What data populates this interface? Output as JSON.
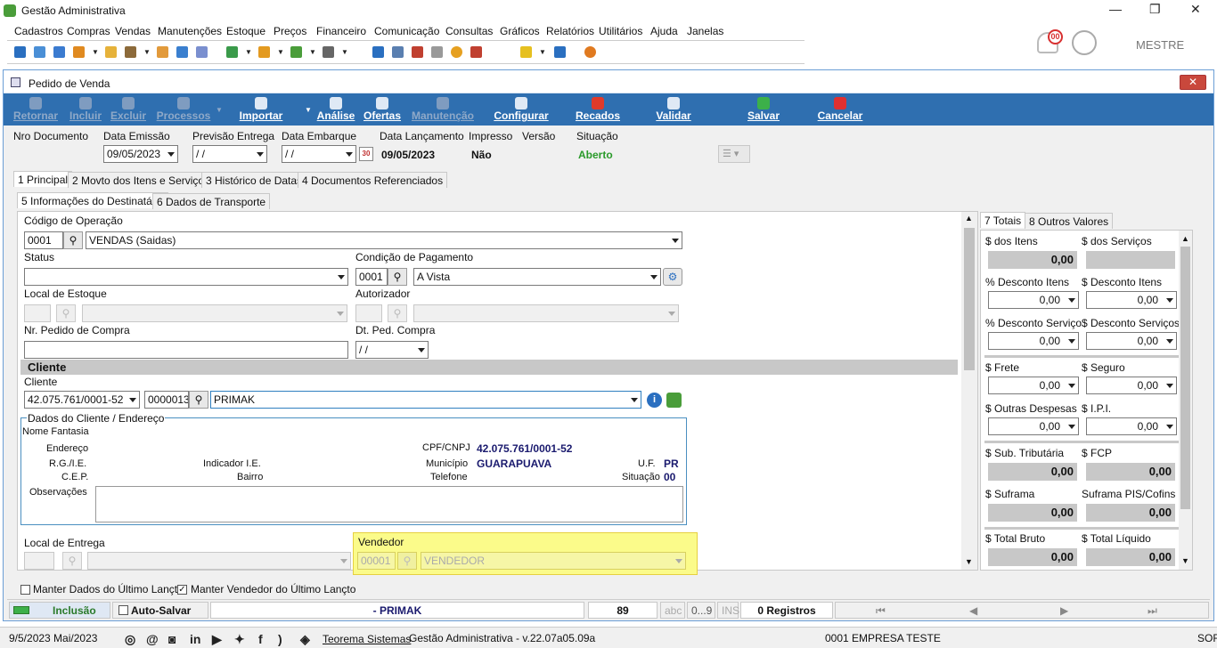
{
  "app": {
    "title": "Gestão Administrativa",
    "user": "MESTRE",
    "notif_count": "00"
  },
  "menu": [
    "Cadastros",
    "Compras",
    "Vendas",
    "Manutenções",
    "Estoque",
    "Preços",
    "Financeiro",
    "Comunicação",
    "Consultas",
    "Gráficos",
    "Relatórios",
    "Utilitários",
    "Ajuda",
    "Janelas"
  ],
  "window": {
    "title": "Pedido de Venda",
    "close": "✕"
  },
  "actions": {
    "retornar": "Retornar",
    "incluir": "Incluir",
    "excluir": "Excluir",
    "processos": "Processos",
    "importar": "Importar",
    "analise": "Análise",
    "ofertas": "Ofertas",
    "manutencao": "Manutenção",
    "configurar": "Configurar",
    "recados": "Recados",
    "validar": "Validar",
    "salvar": "Salvar",
    "cancelar": "Cancelar"
  },
  "header": {
    "nro_doc": "Nro Documento",
    "data_emissao": "Data Emissão",
    "data_emissao_val": "09/05/2023",
    "previsao": "Previsão Entrega",
    "previsao_val": "/ /",
    "embarque": "Data Embarque",
    "embarque_val": "/ /",
    "lancamento": "Data Lançamento",
    "lancamento_val": "09/05/2023",
    "impresso": "Impresso",
    "impresso_val": "Não",
    "versao": "Versão",
    "situacao": "Situação",
    "situacao_val": "Aberto"
  },
  "tabs": [
    "1 Principal",
    "2 Movto dos Itens e Serviços",
    "3 Histórico de Datas",
    "4 Documentos Referenciados"
  ],
  "subtabs": [
    "5 Informações do Destinatário",
    "6 Dados de Transporte"
  ],
  "form": {
    "cod_op_label": "Código de Operação",
    "cod_op": "0001",
    "cod_op_desc": "VENDAS (Saidas)",
    "status_label": "Status",
    "cond_label": "Condição de Pagamento",
    "cond_code": "0001",
    "cond_desc": "A Vista",
    "local_label": "Local de Estoque",
    "autoriz_label": "Autorizador",
    "nr_pedido_label": "Nr. Pedido de Compra",
    "dt_ped_label": "Dt. Ped. Compra",
    "dt_ped_val": "/ /",
    "cliente_section": "Cliente",
    "cliente_label": "Cliente",
    "cliente_cnpj": "42.075.761/0001-52",
    "cliente_code": "0000013",
    "cliente_nome": "PRIMAK",
    "dados_title": "Dados do Cliente / Endereço",
    "nome_fantasia": "Nome Fantasia",
    "endereco": "Endereço",
    "rg": "R.G./I.E.",
    "cep": "C.E.P.",
    "obs": "Observações",
    "indicador": "Indicador I.E.",
    "bairro": "Bairro",
    "cpf_label": "CPF/CNPJ",
    "cpf_val": "42.075.761/0001-52",
    "municipio_label": "Município",
    "municipio_val": "GUARAPUAVA",
    "telefone_label": "Telefone",
    "uf_label": "U.F.",
    "uf_val": "PR",
    "situacao_label": "Situação",
    "situacao_val": "00",
    "local_entrega": "Local de Entrega",
    "vendedor_label": "Vendedor",
    "vendedor_code": "00001",
    "vendedor_desc": "VENDEDOR"
  },
  "totals": {
    "tab1": "7 Totais",
    "tab2": "8 Outros Valores",
    "dos_itens": "$ dos Itens",
    "dos_itens_val": "0,00",
    "dos_servicos": "$ dos Serviços",
    "pct_desc_itens": "% Desconto Itens",
    "pct_desc_itens_val": "0,00",
    "desc_itens": "$ Desconto Itens",
    "desc_itens_val": "0,00",
    "pct_desc_serv": "% Desconto Serviços",
    "pct_desc_serv_val": "0,00",
    "desc_serv": "$ Desconto Serviços",
    "desc_serv_val": "0,00",
    "frete": "$ Frete",
    "frete_val": "0,00",
    "seguro": "$ Seguro",
    "seguro_val": "0,00",
    "outras": "$ Outras Despesas",
    "outras_val": "0,00",
    "ipi": "$ I.P.I.",
    "ipi_val": "0,00",
    "sub_trib": "$ Sub. Tributária",
    "sub_trib_val": "0,00",
    "fcp": "$ FCP",
    "fcp_val": "0,00",
    "suframa": "$ Suframa",
    "suframa_val": "0,00",
    "suframa_pis": "Suframa PIS/Cofins",
    "suframa_pis_val": "0,00",
    "total_bruto": "$ Total Bruto",
    "total_bruto_val": "0,00",
    "total_liq": "$ Total Líquido",
    "total_liq_val": "0,00"
  },
  "options": {
    "manter_dados": "Manter Dados do Último Lançto",
    "manter_vendedor": "Manter Vendedor do Último Lançto"
  },
  "statusbar": {
    "mode": "Inclusão",
    "autosave": "Auto-Salvar",
    "record": "- PRIMAK",
    "count": "89",
    "abc": "abc",
    "range": "0...9",
    "ins": "INS",
    "registros": "0 Registros"
  },
  "footer": {
    "date": "9/5/2023 Mai/2023",
    "company": "Teorema Sistemas",
    "version": "Gestão Administrativa - v.22.07a05.09a",
    "empresa": "0001 EMPRESA TESTE",
    "right": "SOF"
  }
}
